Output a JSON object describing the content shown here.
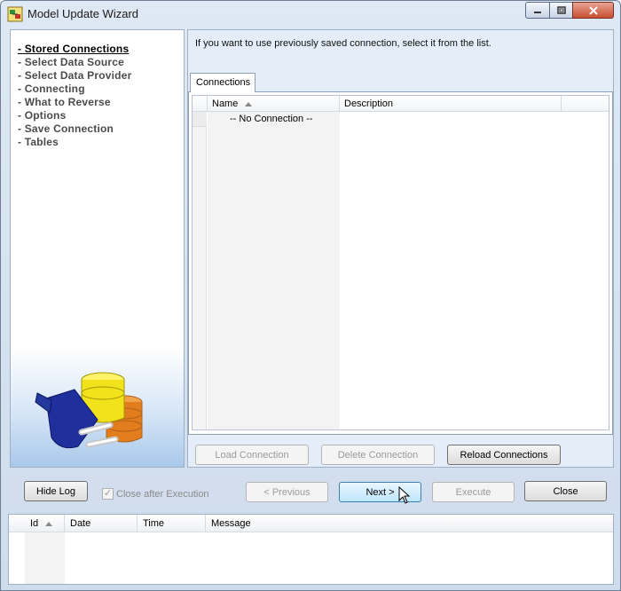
{
  "window": {
    "title": "Model Update Wizard",
    "minimize_icon": "minimize-icon",
    "maximize_icon": "maximize-icon",
    "close_icon": "close-icon"
  },
  "steps": [
    {
      "label": "- Stored Connections",
      "active": true
    },
    {
      "label": "- Select Data Source",
      "active": false
    },
    {
      "label": "- Select Data Provider",
      "active": false
    },
    {
      "label": "- Connecting",
      "active": false
    },
    {
      "label": "- What to Reverse",
      "active": false
    },
    {
      "label": "- Options",
      "active": false
    },
    {
      "label": "- Save Connection",
      "active": false
    },
    {
      "label": "- Tables",
      "active": false
    }
  ],
  "main": {
    "instruction": "If you want to use previously saved connection, select it from the list.",
    "tab_label": "Connections",
    "grid": {
      "columns": [
        "Name",
        "Description"
      ],
      "rows": [
        {
          "name": "-- No Connection --",
          "description": ""
        }
      ]
    },
    "buttons": {
      "load": "Load Connection",
      "delete": "Delete Connection",
      "reload": "Reload Connections"
    }
  },
  "footer": {
    "hide_log": "Hide Log",
    "close_after_execution": "Close after Execution",
    "previous": "< Previous",
    "next": "Next >",
    "execute": "Execute",
    "close": "Close"
  },
  "log": {
    "columns": [
      "Id",
      "Date",
      "Time",
      "Message"
    ]
  },
  "colors": {
    "accent": "#3c7fb1",
    "disabled_text": "#9a9a9a"
  }
}
